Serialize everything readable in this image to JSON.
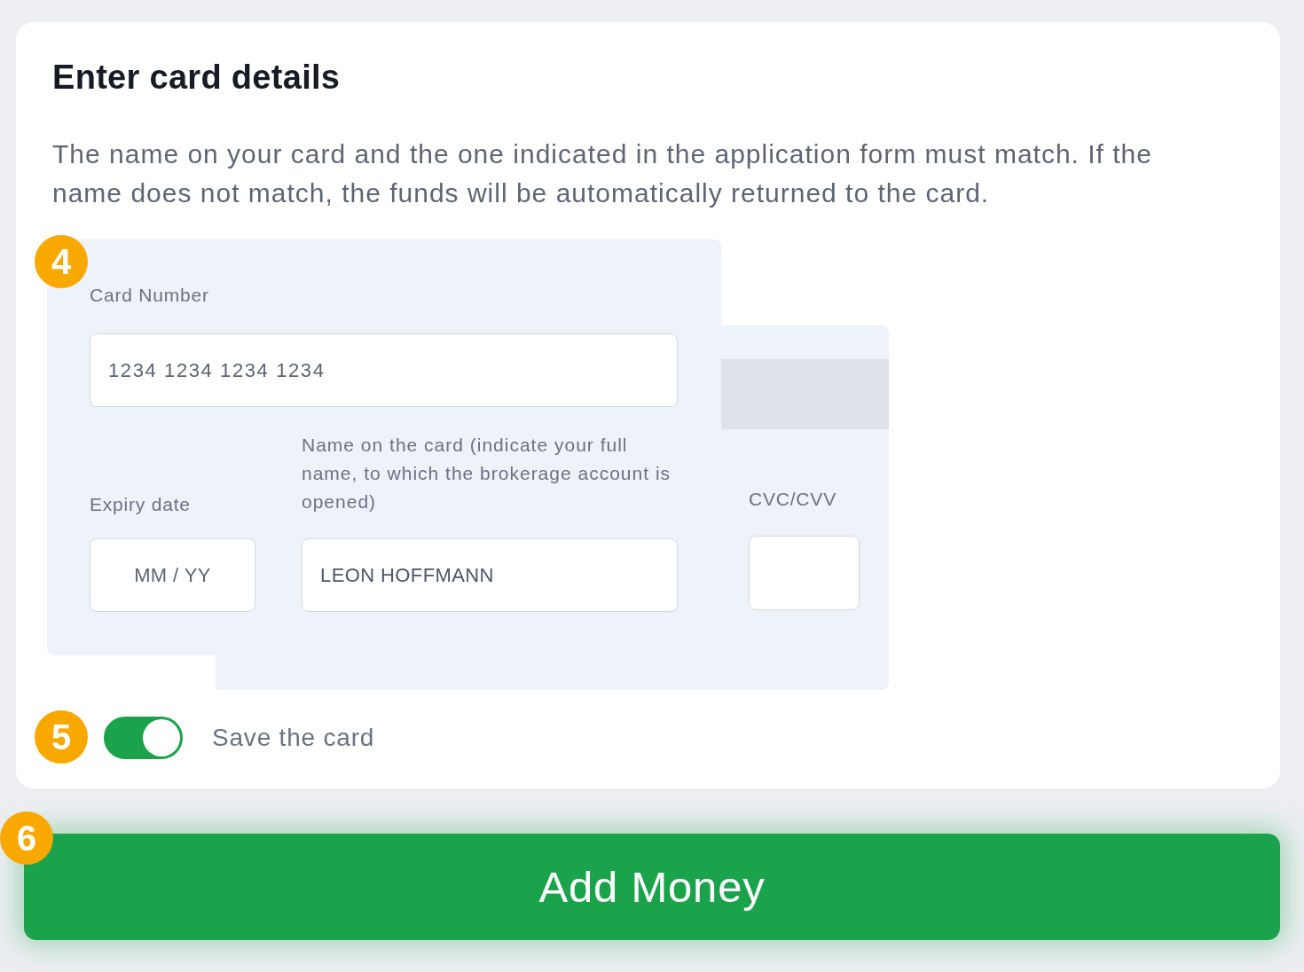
{
  "card": {
    "title": "Enter card details",
    "description": "The name on your card and the one indicated in the application form must match. If the name does not match, the funds will be automatically returned to the card."
  },
  "card_form": {
    "marker": "4",
    "card_number": {
      "label": "Card Number",
      "placeholder": "1234 1234 1234 1234"
    },
    "expiry_date": {
      "label": "Expiry date",
      "placeholder": "MM / YY"
    },
    "name_on_card": {
      "label": "Name on the card (indicate your full name, to which the brokerage account is opened)",
      "value": "LEON HOFFMANN"
    },
    "cvc": {
      "label": "CVC/CVV"
    }
  },
  "save_card": {
    "marker": "5",
    "label": "Save the card",
    "on": true
  },
  "add_money_button": {
    "marker": "6",
    "label": "Add Money"
  }
}
